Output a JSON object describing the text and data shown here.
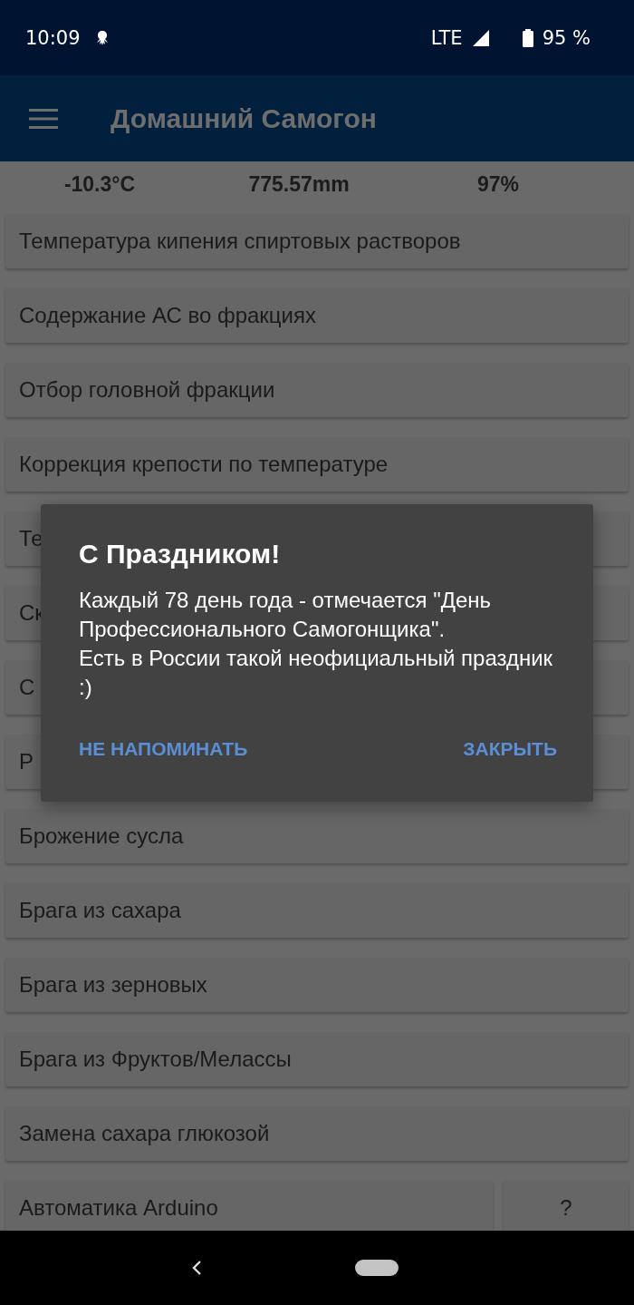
{
  "status_bar": {
    "time": "10:09",
    "network": "LTE",
    "battery": "95 %"
  },
  "app_bar": {
    "title": "Домашний Самогон"
  },
  "weather": {
    "temperature": "-10.3°C",
    "pressure": "775.57mm",
    "humidity": "97%"
  },
  "menu_items": [
    {
      "label": "Температура кипения спиртовых растворов"
    },
    {
      "label": "Содержание АС во фракциях"
    },
    {
      "label": "Отбор головной фракции"
    },
    {
      "label": "Коррекция крепости по температуре"
    },
    {
      "label": "Те"
    },
    {
      "label": "Ск"
    },
    {
      "label": "С"
    },
    {
      "label": "Р"
    },
    {
      "label": "Брожение сусла"
    },
    {
      "label": "Брага из сахара"
    },
    {
      "label": "Брага из зерновых"
    },
    {
      "label": "Брага из Фруктов/Мелассы"
    },
    {
      "label": "Замена сахара глюкозой"
    }
  ],
  "last_row": {
    "label": "Автоматика Arduino",
    "help": "?"
  },
  "dialog": {
    "title": "С Праздником!",
    "message": "Каждый 78 день года - отмечается \"День Профессионального Самогонщика\".\nЕсть в России такой неофициальный праздник :)",
    "buttons": [
      "НЕ НАПОМИНАТЬ",
      "ЗАКРЫТЬ"
    ]
  }
}
